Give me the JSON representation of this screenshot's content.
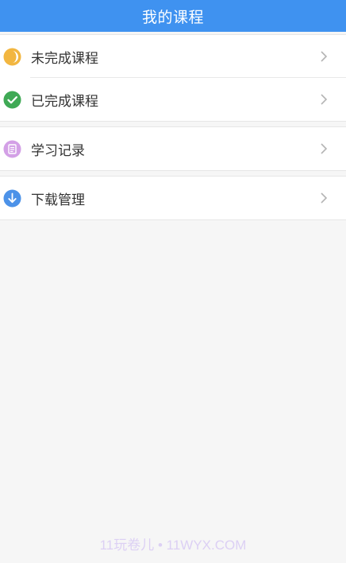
{
  "header": {
    "title": "我的课程",
    "color": "#3f92f0"
  },
  "menu": {
    "incomplete": {
      "label": "未完成课程",
      "icon": "half-moon-icon",
      "color": "#f2b640"
    },
    "completed": {
      "label": "已完成课程",
      "icon": "check-circle-icon",
      "color": "#3fa955"
    },
    "records": {
      "label": "学习记录",
      "icon": "document-icon",
      "color": "#d3a0e6"
    },
    "downloads": {
      "label": "下载管理",
      "icon": "download-arrow-icon",
      "color": "#4c92e8"
    },
    "chevron_icon": "chevron-right-icon"
  },
  "watermark": {
    "text": "11玩卷儿 • 11WYX.COM"
  }
}
